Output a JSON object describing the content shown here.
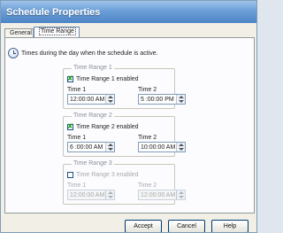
{
  "window": {
    "title": "Schedule Properties"
  },
  "tabs": [
    {
      "label": "General"
    },
    {
      "label": "Time Range"
    }
  ],
  "info": {
    "text": "Times during the day when the schedule is active."
  },
  "ranges": [
    {
      "legend": "Time Range 1",
      "checked": true,
      "enabled_label": "Time Range 1 enabled",
      "time1_label": "Time 1",
      "time1_value": "12:00:00 AM",
      "time2_label": "Time 2",
      "time2_value": "5 :00:00 PM"
    },
    {
      "legend": "Time Range 2",
      "checked": true,
      "enabled_label": "Time Range 2 enabled",
      "time1_label": "Time 1",
      "time1_value": "6 :00:00 AM",
      "time2_label": "Time 2",
      "time2_value": "10:00:00 AM"
    },
    {
      "legend": "Time Range 3",
      "checked": false,
      "enabled_label": "Time Range 3 enabled",
      "time1_label": "Time 1",
      "time1_value": "12:00:00 AM",
      "time2_label": "Time 2",
      "time2_value": "12:00:00 AM"
    }
  ],
  "buttons": {
    "accept": "Accept",
    "cancel": "Cancel",
    "help": "Help"
  },
  "icons": {
    "info": "clock-info-icon",
    "check": "check-mark-icon",
    "spin": "spin-arrows-icon"
  },
  "colors": {
    "titlebar": "#5b8fd0",
    "check": "#21a121"
  }
}
